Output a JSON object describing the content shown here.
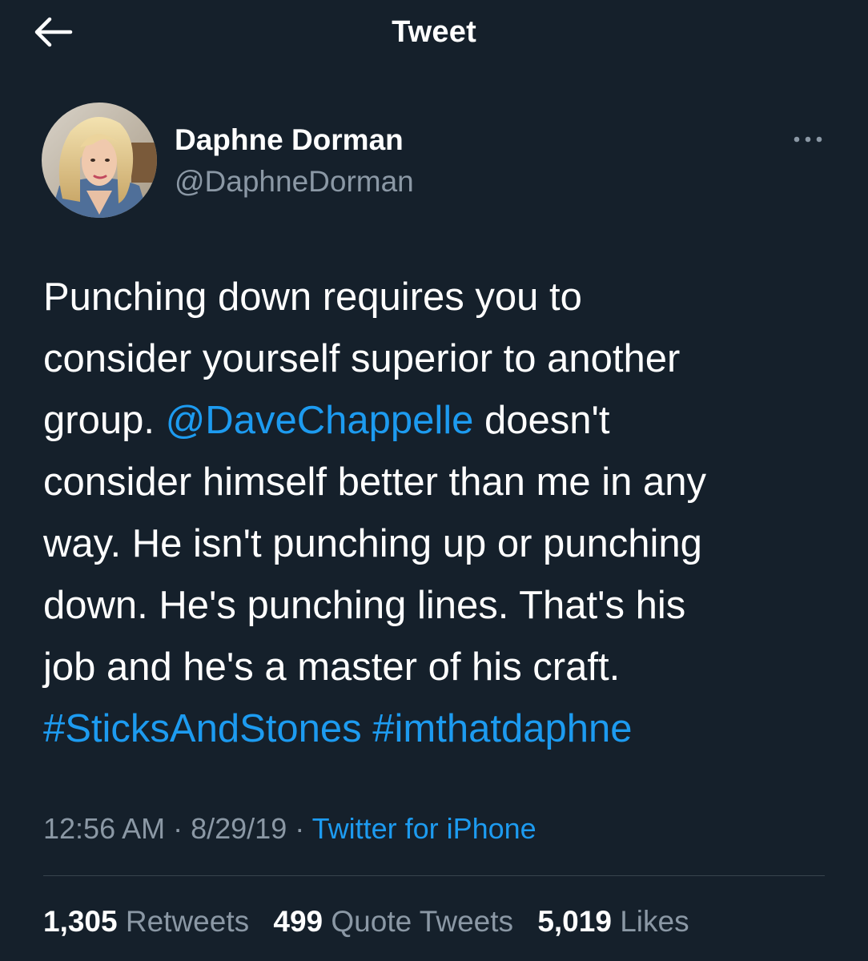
{
  "header": {
    "back_icon": "back-arrow-icon",
    "title": "Tweet"
  },
  "author": {
    "display_name": "Daphne Dorman",
    "handle": "@DaphneDorman",
    "more_icon": "more-options-icon"
  },
  "tweet": {
    "lines": [
      [
        {
          "t": "Punching down requires you to"
        }
      ],
      [
        {
          "t": "consider yourself superior to another"
        }
      ],
      [
        {
          "t": "group. "
        },
        {
          "t": "@DaveChappelle",
          "link": true
        },
        {
          "t": " doesn't"
        }
      ],
      [
        {
          "t": "consider himself better than me in any"
        }
      ],
      [
        {
          "t": "way. He isn't punching up or punching"
        }
      ],
      [
        {
          "t": "down. He's punching lines. That's his"
        }
      ],
      [
        {
          "t": "job and he's a master of his craft."
        }
      ],
      [
        {
          "t": "#SticksAndStones",
          "link": true
        },
        {
          "t": " "
        },
        {
          "t": "#imthatdaphne",
          "link": true
        }
      ]
    ],
    "time": "12:56 AM",
    "date": "8/29/19",
    "separator": " · ",
    "source": "Twitter for iPhone"
  },
  "stats": {
    "retweets_count": "1,305",
    "retweets_label": "Retweets",
    "quotes_count": "499",
    "quotes_label": "Quote Tweets",
    "likes_count": "5,019",
    "likes_label": "Likes"
  },
  "colors": {
    "background": "#15202b",
    "link": "#1d9bf0",
    "secondary_text": "#8b98a5",
    "divider": "#38444d"
  }
}
